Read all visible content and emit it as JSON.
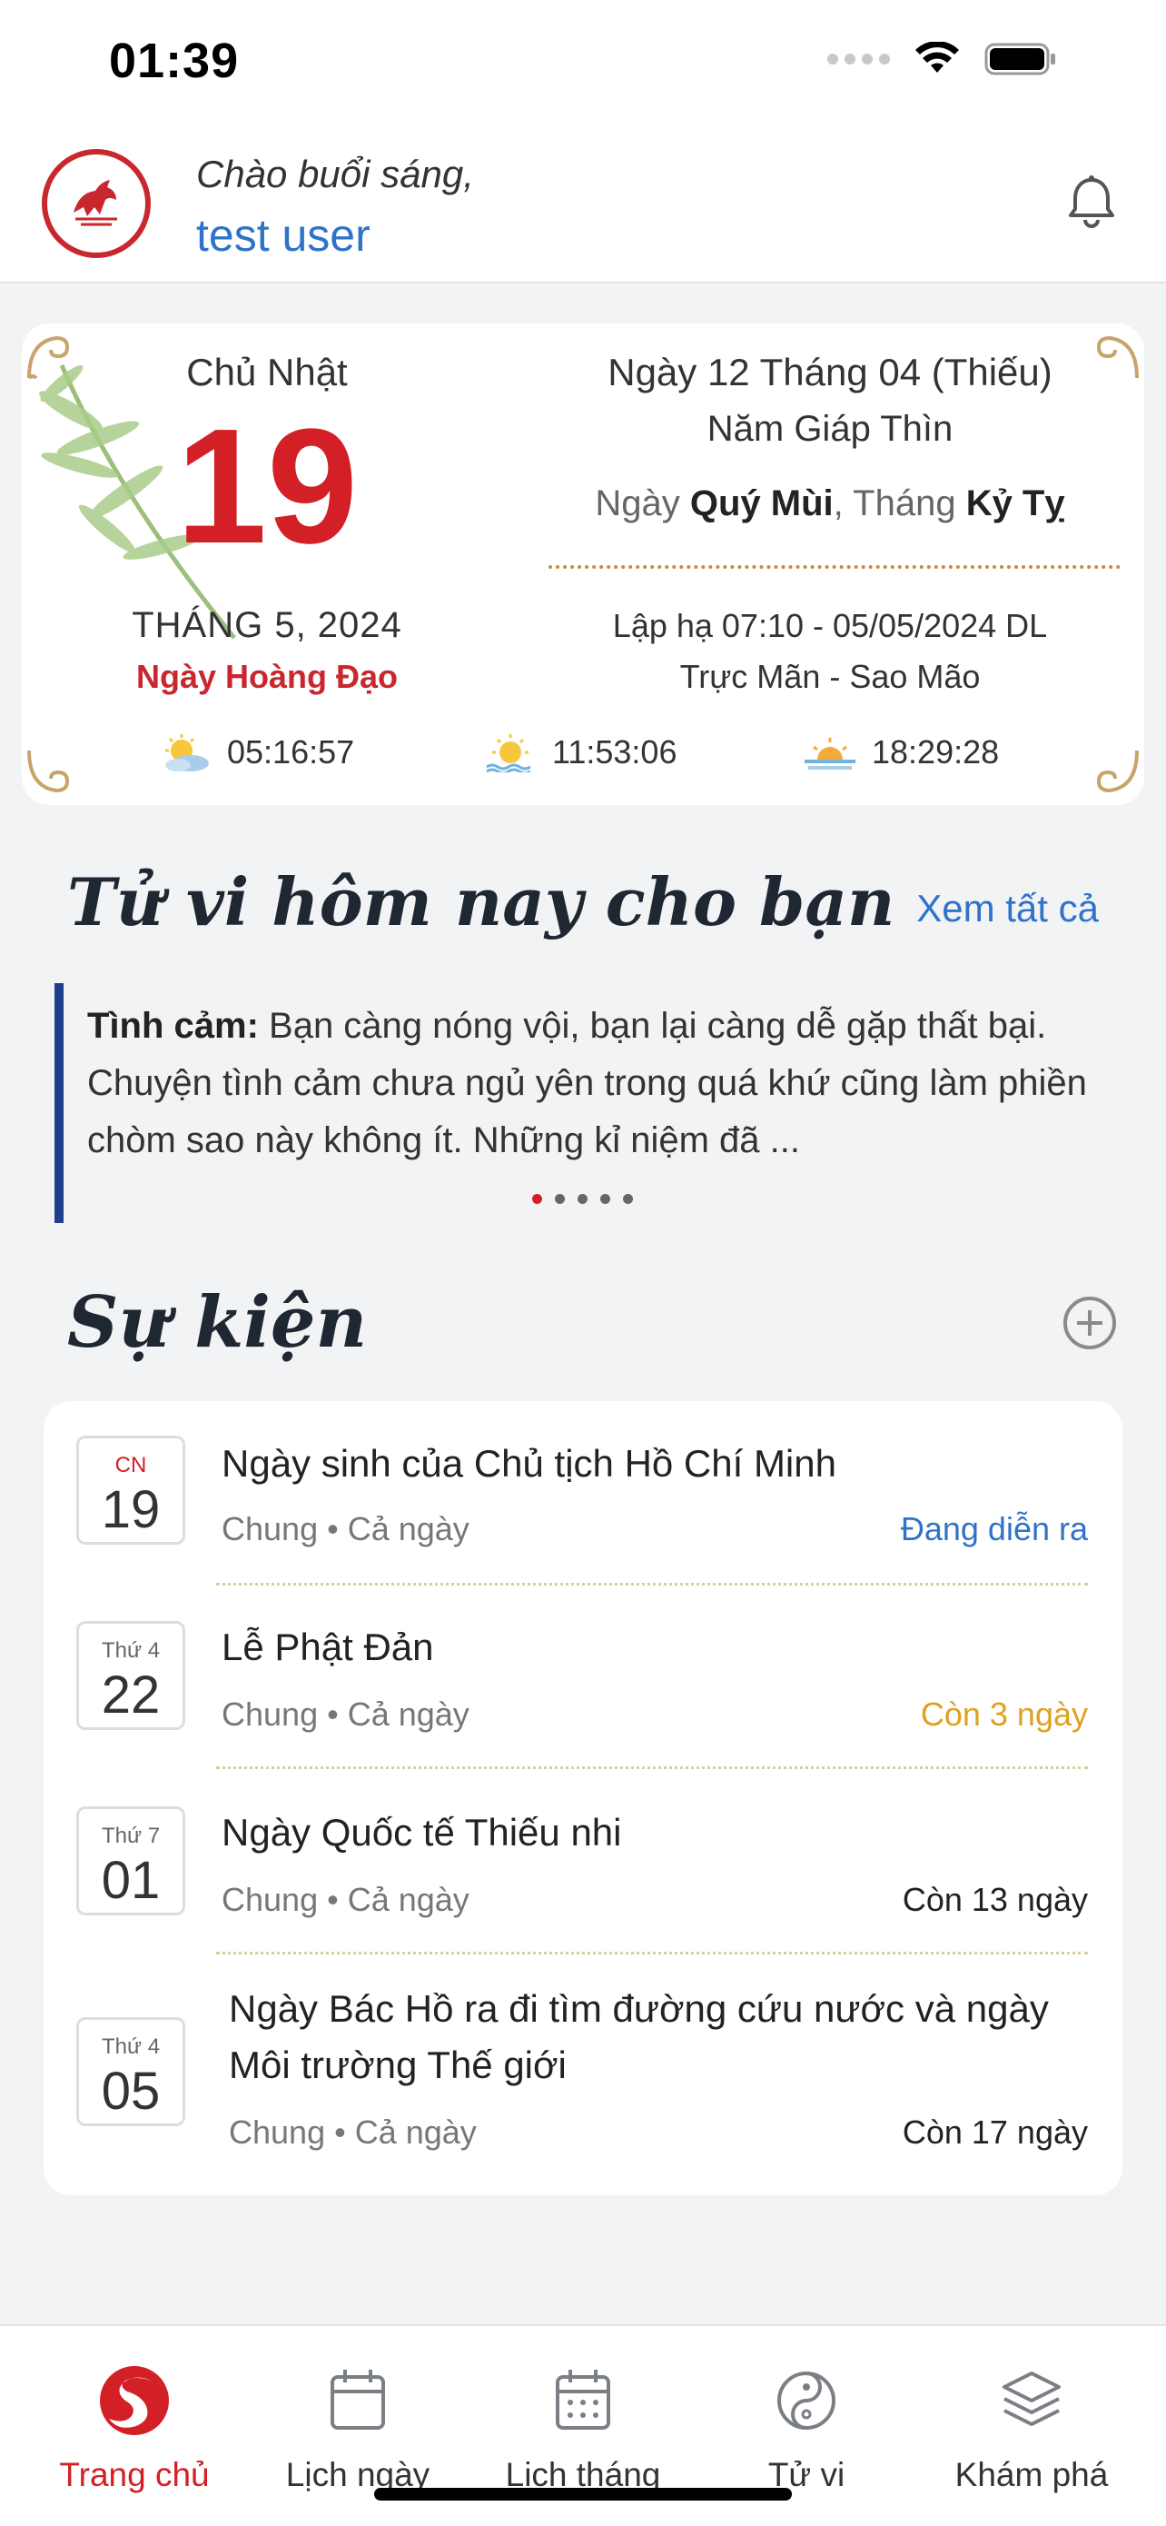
{
  "status_bar": {
    "time": "01:39"
  },
  "header": {
    "greeting": "Chào buổi sáng,",
    "username": "test user"
  },
  "calendar": {
    "weekday": "Chủ Nhật",
    "day": "19",
    "month_year": "THÁNG 5, 2024",
    "day_quality": "Ngày Hoàng Đạo",
    "lunar_date": "Ngày 12 Tháng 04 (Thiếu)",
    "lunar_year": "Năm Giáp Thìn",
    "canchi_day_prefix": "Ngày ",
    "canchi_day": "Quý Mùi",
    "canchi_month_prefix": ", Tháng ",
    "canchi_month": "Kỷ Tỵ",
    "solar_term": "Lập hạ 07:10 - 05/05/2024 DL",
    "truc_sao": "Trực Mãn - Sao Mão",
    "sunrise": "05:16:57",
    "noon": "11:53:06",
    "sunset": "18:29:28"
  },
  "tuvi": {
    "title": "Tử vi hôm nay cho bạn",
    "see_all": "Xem tất cả",
    "label": "Tình cảm:",
    "text": " Bạn càng nóng vội, bạn lại càng dễ gặp thất bại. Chuyện tình cảm chưa ngủ yên trong quá khứ cũng làm phiền chòm sao này không ít. Những kỉ niệm đã ..."
  },
  "events": {
    "title": "Sự kiện",
    "items": [
      {
        "weekday": "CN",
        "day": "19",
        "title": "Ngày sinh của Chủ tịch Hồ Chí Minh",
        "category": "Chung",
        "time": "Cả ngày",
        "status": "Đang diễn ra",
        "status_color": "#2f73c9"
      },
      {
        "weekday": "Thứ 4",
        "day": "22",
        "title": "Lễ Phật Đản",
        "category": "Chung",
        "time": "Cả ngày",
        "status": "Còn 3 ngày",
        "status_color": "#e0a020"
      },
      {
        "weekday": "Thứ 7",
        "day": "01",
        "title": "Ngày Quốc tế Thiếu nhi",
        "category": "Chung",
        "time": "Cả ngày",
        "status": "Còn 13 ngày",
        "status_color": "#222222"
      },
      {
        "weekday": "Thứ 4",
        "day": "05",
        "title": "Ngày Bác Hồ ra đi tìm đường cứu nước và ngày Môi trường Thế giới",
        "category": "Chung",
        "time": "Cả ngày",
        "status": "Còn 17 ngày",
        "status_color": "#222222"
      }
    ]
  },
  "tabbar": {
    "items": [
      {
        "label": "Trang chủ",
        "icon": "app-logo-icon",
        "active": true
      },
      {
        "label": "Lịch ngày",
        "icon": "calendar-day-icon",
        "active": false
      },
      {
        "label": "Lịch tháng",
        "icon": "calendar-month-icon",
        "active": false
      },
      {
        "label": "Tử vi",
        "icon": "yin-yang-icon",
        "active": false
      },
      {
        "label": "Khám phá",
        "icon": "layers-icon",
        "active": false
      }
    ]
  },
  "colors": {
    "accent": "#d32026",
    "link": "#2f73c9",
    "background": "#f2f3f5"
  }
}
